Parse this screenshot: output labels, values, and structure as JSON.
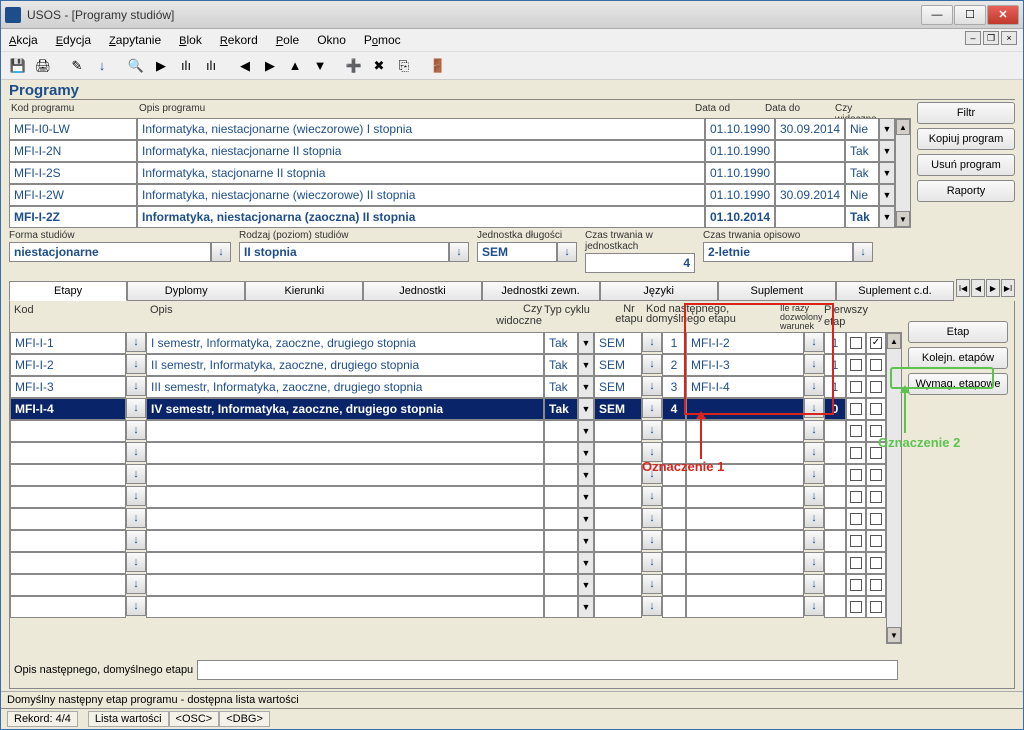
{
  "window": {
    "title": "USOS - [Programy studiów]"
  },
  "menu": [
    "Akcja",
    "Edycja",
    "Zapytanie",
    "Blok",
    "Rekord",
    "Pole",
    "Okno",
    "Pomoc"
  ],
  "section_title": "Programy",
  "prog_headers": {
    "kod": "Kod programu",
    "opis": "Opis programu",
    "data_od": "Data od",
    "data_do": "Data do",
    "czy": "Czy widoczne"
  },
  "programs": [
    {
      "kod": "MFI-I0-LW",
      "opis": "Informatyka, niestacjonarne (wieczorowe) I stopnia",
      "od": "01.10.1990",
      "do": "30.09.2014",
      "czy": "Nie"
    },
    {
      "kod": "MFI-I-2N",
      "opis": "Informatyka, niestacjonarne II stopnia",
      "od": "01.10.1990",
      "do": "",
      "czy": "Tak"
    },
    {
      "kod": "MFI-I-2S",
      "opis": "Informatyka, stacjonarne II stopnia",
      "od": "01.10.1990",
      "do": "",
      "czy": "Tak"
    },
    {
      "kod": "MFI-I-2W",
      "opis": "Informatyka, niestacjonarne (wieczorowe) II stopnia",
      "od": "01.10.1990",
      "do": "30.09.2014",
      "czy": "Nie"
    },
    {
      "kod": "MFI-I-2Z",
      "opis": "Informatyka, niestacjonarna (zaoczna) II stopnia",
      "od": "01.10.2014",
      "do": "",
      "czy": "Tak",
      "bold": true
    }
  ],
  "side_buttons": [
    "Filtr",
    "Kopiuj program",
    "Usuń program",
    "Raporty"
  ],
  "form": {
    "forma_label": "Forma studiów",
    "forma": "niestacjonarne",
    "rodzaj_label": "Rodzaj (poziom) studiów",
    "rodzaj": "II stopnia",
    "jedn_label": "Jednostka długości",
    "jedn": "SEM",
    "czas_j_label": "Czas trwania w jednostkach",
    "czas_j": "4",
    "czas_o_label": "Czas trwania opisowo",
    "czas_o": "2-letnie"
  },
  "tabs": [
    "Etapy",
    "Dyplomy",
    "Kierunki",
    "Jednostki",
    "Jednostki zewn.",
    "Języki",
    "Suplement",
    "Suplement c.d."
  ],
  "etapy_headers": {
    "kod": "Kod",
    "opis": "Opis",
    "czy": "Czy widoczne",
    "typ": "Typ cyklu",
    "nr": "Nr etapu",
    "kodnast": "Kod następnego, domyślnego etapu",
    "ile": "Ile razy dozwolony warunek",
    "pierwszy": "Pierwszy etap"
  },
  "etapy": [
    {
      "kod": "MFI-I-1",
      "opis": "I semestr, Informatyka, zaoczne, drugiego stopnia",
      "czy": "Tak",
      "typ": "SEM",
      "nr": "1",
      "nast": "MFI-I-2",
      "ile": "1",
      "pierw": true
    },
    {
      "kod": "MFI-I-2",
      "opis": "II semestr, Informatyka, zaoczne, drugiego stopnia",
      "czy": "Tak",
      "typ": "SEM",
      "nr": "2",
      "nast": "MFI-I-3",
      "ile": "1",
      "pierw": false
    },
    {
      "kod": "MFI-I-3",
      "opis": "III semestr, Informatyka, zaoczne, drugiego stopnia",
      "czy": "Tak",
      "typ": "SEM",
      "nr": "3",
      "nast": "MFI-I-4",
      "ile": "1",
      "pierw": false
    },
    {
      "kod": "MFI-I-4",
      "opis": "IV semestr, Informatyka, zaoczne, drugiego stopnia",
      "czy": "Tak",
      "typ": "SEM",
      "nr": "4",
      "nast": "",
      "ile": "0",
      "pierw": false,
      "selected": true
    }
  ],
  "etapy_side_buttons": [
    "Etap",
    "Kolejn. etapów",
    "Wymag. etapowe"
  ],
  "opis_label": "Opis następnego, domyślnego etapu",
  "status_line": "Domyślny następny etap programu - dostępna lista wartości",
  "footer": {
    "rekord": "Rekord: 4/4",
    "lista": "Lista wartości",
    "osc": "<OSC>",
    "dbg": "<DBG>"
  },
  "annotations": {
    "ozn1": "Oznaczenie 1",
    "ozn2": "Oznaczenie 2"
  }
}
